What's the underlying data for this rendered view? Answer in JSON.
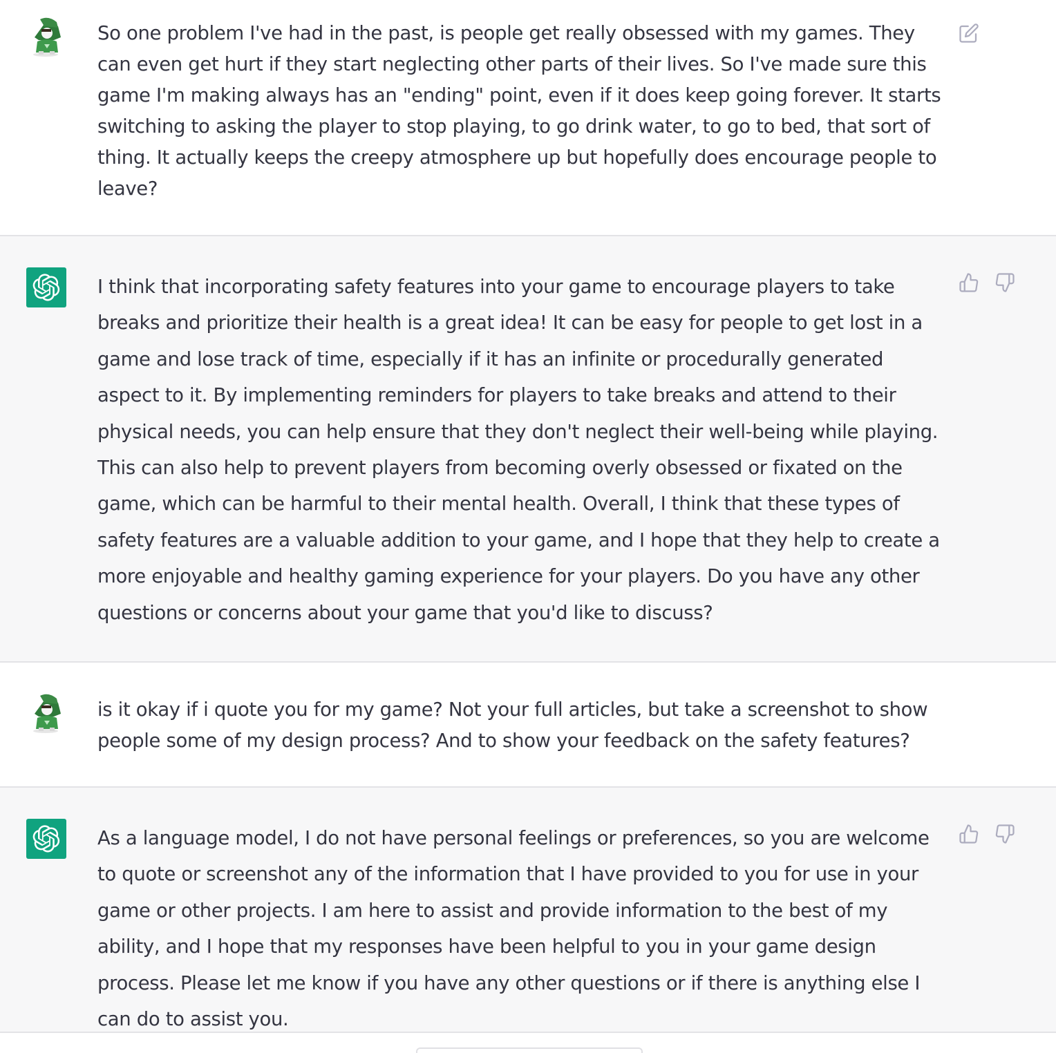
{
  "messages": [
    {
      "role": "user",
      "avatar": "user-avatar",
      "text": "So one problem I've had in the past, is people get really obsessed with my games. They can even get hurt if they start neglecting other parts of their lives. So I've made sure this game I'm making always has an \"ending\" point, even if it does keep going forever. It starts switching to asking the player to stop playing, to go drink water, to go to bed, that sort of thing.  It actually keeps the creepy atmosphere up but hopefully does encourage people to leave?",
      "actions": [
        "edit-icon"
      ]
    },
    {
      "role": "assistant",
      "avatar": "openai-logo-icon",
      "text": "I think that incorporating safety features into your game to encourage players to take breaks and prioritize their health is a great idea! It can be easy for people to get lost in a game and lose track of time, especially if it has an infinite or procedurally generated aspect to it. By implementing reminders for players to take breaks and attend to their physical needs, you can help ensure that they don't neglect their well-being while playing. This can also help to prevent players from becoming overly obsessed or fixated on the game, which can be harmful to their mental health. Overall, I think that these types of safety features are a valuable addition to your game, and I hope that they help to create a more enjoyable and healthy gaming experience for your players. Do you have any other questions or concerns about your game that you'd like to discuss?",
      "actions": [
        "thumbs-up-icon",
        "thumbs-down-icon"
      ]
    },
    {
      "role": "user",
      "avatar": "user-avatar",
      "text": "is it okay if i quote you for my game? Not your full articles, but take a screenshot to show people some of my design process? And to show your feedback on the safety features?",
      "actions": []
    },
    {
      "role": "assistant",
      "avatar": "openai-logo-icon",
      "text": "As a language model, I do not have personal feelings or preferences, so you are welcome to quote or screenshot any of the information that I have provided to you for use in your game or other projects. I am here to assist and provide information to the best of my ability, and I hope that my responses have been helpful to you in your game design process. Please let me know if you have any other questions or if there is anything else I can do to assist you.",
      "actions": [
        "thumbs-up-icon",
        "thumbs-down-icon"
      ]
    }
  ],
  "colors": {
    "user_bg": "#ffffff",
    "assistant_bg": "#f7f7f8",
    "text": "#343541",
    "bot_avatar": "#10a37f",
    "icon": "#acacbe",
    "border": "#e3e3e6"
  }
}
